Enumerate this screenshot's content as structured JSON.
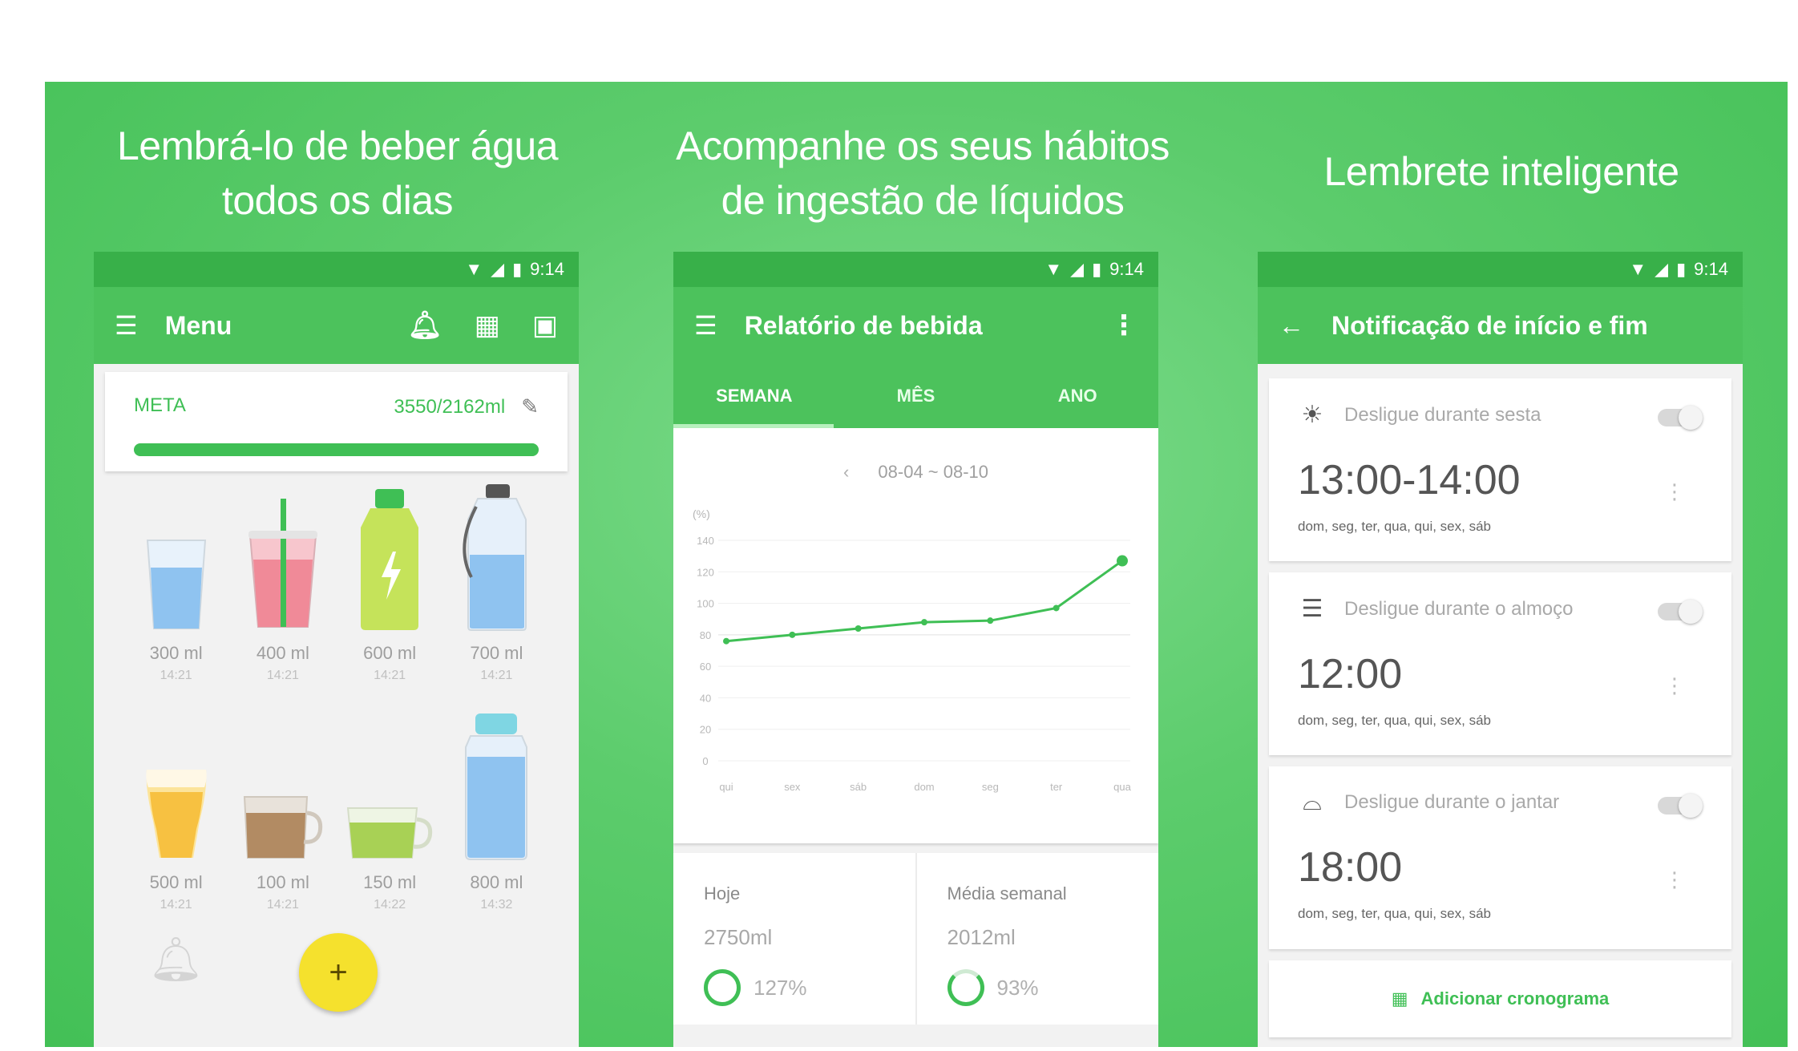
{
  "panels": [
    {
      "caption": "Lembrá-lo de beber água\ntodos os dias"
    },
    {
      "caption": "Acompanhe os seus hábitos\nde ingestão de líquidos"
    },
    {
      "caption": "Lembrete  inteligente"
    }
  ],
  "status_bar": {
    "time": "9:14"
  },
  "phone1": {
    "appbar_title": "Menu",
    "goal": {
      "label": "META",
      "value": "3550/2162ml",
      "progress_fraction": 1.0
    },
    "cups": [
      {
        "label": "300 ml",
        "time": "14:21",
        "icon": "glass-water-icon"
      },
      {
        "label": "400 ml",
        "time": "14:21",
        "icon": "smoothie-cup-icon"
      },
      {
        "label": "600 ml",
        "time": "14:21",
        "icon": "sports-drink-icon"
      },
      {
        "label": "700 ml",
        "time": "14:21",
        "icon": "sports-bottle-icon"
      },
      {
        "label": "500 ml",
        "time": "14:21",
        "icon": "beer-glass-icon"
      },
      {
        "label": "100 ml",
        "time": "14:21",
        "icon": "coffee-cup-icon"
      },
      {
        "label": "150 ml",
        "time": "14:22",
        "icon": "tea-cup-icon"
      },
      {
        "label": "800 ml",
        "time": "14:32",
        "icon": "water-bottle-icon"
      }
    ],
    "fab_label": "+"
  },
  "phone2": {
    "appbar_title": "Relatório de bebida",
    "tabs": [
      "SEMANA",
      "MÊS",
      "ANO"
    ],
    "range": "08-04 ~ 08-10",
    "stats": [
      {
        "label": "Hoje",
        "value": "2750ml",
        "pct": "127%"
      },
      {
        "label": "Média semanal",
        "value": "2012ml",
        "pct": "93%"
      }
    ]
  },
  "chart_data": {
    "type": "line",
    "title": "",
    "xlabel": "",
    "ylabel": "(%)",
    "categories": [
      "qui",
      "sex",
      "sáb",
      "dom",
      "seg",
      "ter",
      "qua"
    ],
    "y_ticks": [
      0,
      20,
      40,
      60,
      80,
      100,
      120,
      140
    ],
    "ylim": [
      0,
      140
    ],
    "series": [
      {
        "values": [
          76,
          80,
          84,
          88,
          89,
          97,
          127
        ]
      }
    ],
    "grid": true,
    "line_color": "#3fbf55"
  },
  "phone3": {
    "appbar_title": "Notificação de início e fim",
    "reminders": [
      {
        "title": "Desligue durante sesta",
        "time": "13:00-14:00",
        "days": "dom, seg, ter, qua, qui, sex, sáb",
        "icon": "nap-icon",
        "enabled": false
      },
      {
        "title": "Desligue durante o almoço",
        "time": "12:00",
        "days": "dom, seg, ter, qua, qui, sex, sáb",
        "icon": "lunch-icon",
        "enabled": false
      },
      {
        "title": "Desligue durante o jantar",
        "time": "18:00",
        "days": "dom, seg, ter, qua, qui, sex, sáb",
        "icon": "dinner-icon",
        "enabled": false
      }
    ],
    "add_label": "Adicionar cronograma"
  },
  "colors": {
    "accent": "#4cc25c",
    "status": "#38b049",
    "fab": "#f5e12d"
  }
}
